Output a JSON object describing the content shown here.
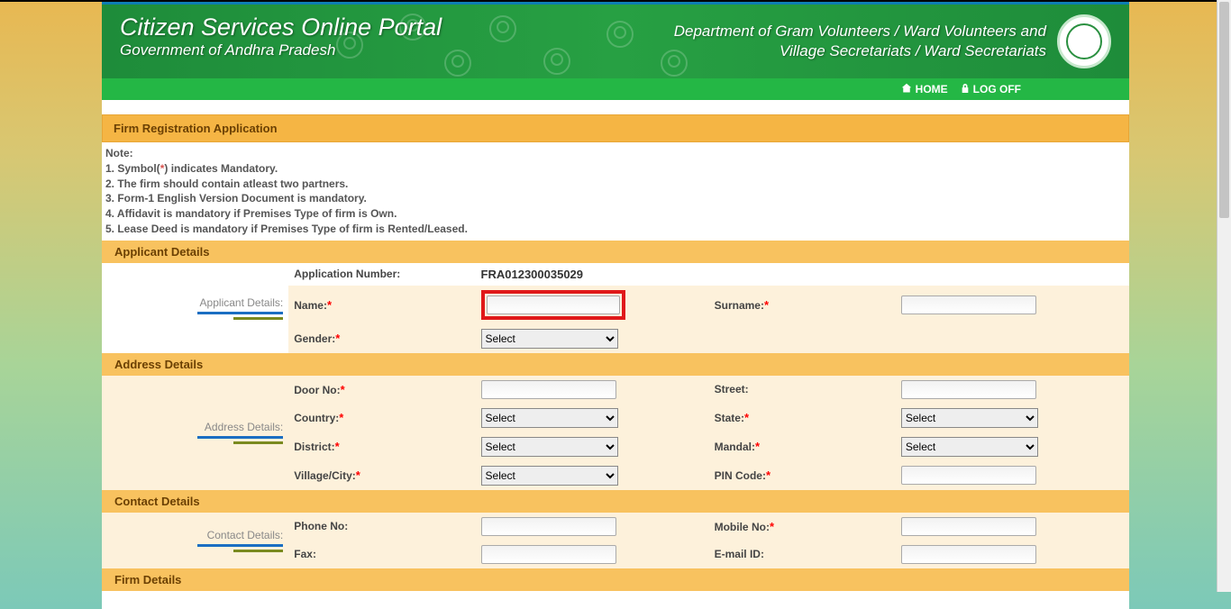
{
  "header": {
    "title1": "Citizen Services Online Portal",
    "title2": "Government of Andhra Pradesh",
    "right1": "Department of Gram Volunteers / Ward Volunteers and",
    "right2": "Village Secretariats / Ward Secretariats"
  },
  "nav": {
    "home": "HOME",
    "logoff": "LOG OFF"
  },
  "form_title": "Firm Registration Application",
  "notes": {
    "hdr": "Note:",
    "n1a": "1. Symbol(",
    "n1b": ") indicates Mandatory.",
    "n2": "2. The firm should contain atleast two partners.",
    "n3": "3. Form-1 English Version Document is mandatory.",
    "n4": "4. Affidavit is mandatory if Premises Type of firm is Own.",
    "n5": "5. Lease Deed is mandatory if Premises Type of firm is Rented/Leased."
  },
  "sections": {
    "applicant": {
      "title": "Applicant Details",
      "side": "Applicant Details:",
      "app_num_lbl": "Application Number:",
      "app_num_val": "FRA012300035029",
      "name_lbl": "Name:",
      "surname_lbl": "Surname:",
      "gender_lbl": "Gender:",
      "gender_sel": "Select"
    },
    "address": {
      "title": "Address Details",
      "side": "Address Details:",
      "door_lbl": "Door No:",
      "street_lbl": "Street:",
      "country_lbl": "Country:",
      "country_sel": "Select",
      "state_lbl": "State:",
      "state_sel": "Select",
      "district_lbl": "District:",
      "district_sel": "Select",
      "mandal_lbl": "Mandal:",
      "mandal_sel": "Select",
      "village_lbl": "Village/City:",
      "village_sel": "Select",
      "pin_lbl": "PIN Code:"
    },
    "contact": {
      "title": "Contact Details",
      "side": "Contact Details:",
      "phone_lbl": "Phone No:",
      "mobile_lbl": "Mobile No:",
      "fax_lbl": "Fax:",
      "email_lbl": "E-mail ID:"
    },
    "firm": {
      "title": "Firm Details"
    }
  },
  "star": "*"
}
